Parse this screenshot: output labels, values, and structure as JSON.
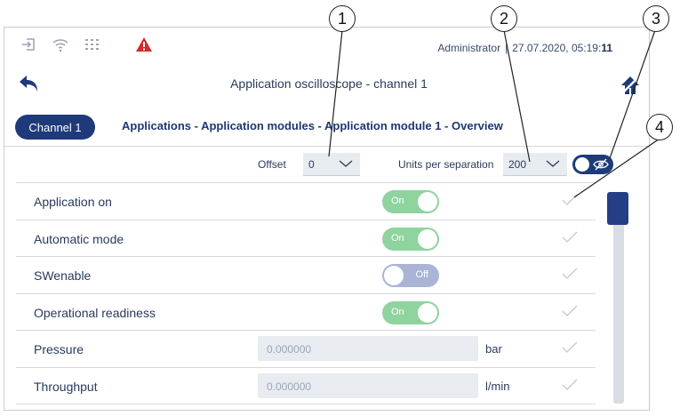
{
  "status_bar": {
    "icons": [
      "login-icon",
      "wifi-icon",
      "network-grid-icon",
      "warning-icon"
    ],
    "user": "Administrator",
    "datetime_prefix": "27.07.2020, 05:19:",
    "datetime_seconds": "11",
    "separator": "|"
  },
  "header": {
    "title": "Application oscilloscope - channel 1"
  },
  "channel_tab": "Channel 1",
  "breadcrumb": "Applications - Application modules - Application module 1 - Overview",
  "controls": {
    "offset_label": "Offset",
    "offset_value": "0",
    "units_label": "Units per separation",
    "units_value": "200"
  },
  "rows": [
    {
      "label": "Application on",
      "type": "toggle",
      "state": "On"
    },
    {
      "label": "Automatic mode",
      "type": "toggle",
      "state": "On"
    },
    {
      "label": "SWenable",
      "type": "toggle",
      "state": "Off"
    },
    {
      "label": "Operational readiness",
      "type": "toggle",
      "state": "On"
    },
    {
      "label": "Pressure",
      "type": "field",
      "value": "0.000000",
      "unit": "bar"
    },
    {
      "label": "Throughput",
      "type": "field",
      "value": "0.000000",
      "unit": "l/min"
    }
  ],
  "callouts": [
    "1",
    "2",
    "3",
    "4"
  ],
  "colors": {
    "primary": "#1e3a7a",
    "toggle_on": "#8fd39e",
    "toggle_off": "#aab4d6",
    "warning": "#d22b2b"
  }
}
